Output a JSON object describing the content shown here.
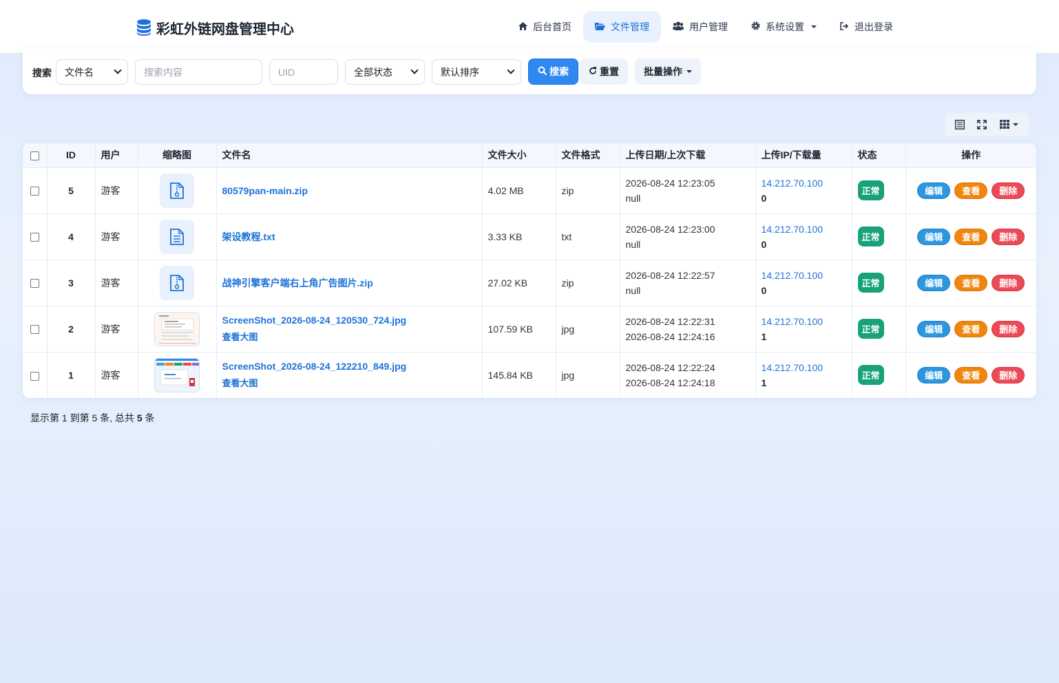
{
  "brand": {
    "title": "彩虹外链网盘管理中心",
    "icon": "database-icon",
    "icon_color": "#1d72d8"
  },
  "nav": [
    {
      "label": "后台首页",
      "icon": "home-icon",
      "active": false
    },
    {
      "label": "文件管理",
      "icon": "folder-open-icon",
      "active": true
    },
    {
      "label": "用户管理",
      "icon": "users-icon",
      "active": false
    },
    {
      "label": "系统设置",
      "icon": "gear-icon",
      "active": false,
      "dropdown": true
    },
    {
      "label": "退出登录",
      "icon": "sign-out-icon",
      "active": false
    }
  ],
  "search": {
    "label": "搜索",
    "field_select": "文件名",
    "keyword_placeholder": "搜索内容",
    "uid_placeholder": "UID",
    "status_select": "全部状态",
    "sort_select": "默认排序",
    "search_button": "搜索",
    "reset_button": "重置",
    "batch_button": "批量操作"
  },
  "toolbar": {
    "icons": [
      "list-icon",
      "fullscreen-icon",
      "columns-icon"
    ]
  },
  "table": {
    "headers": [
      "ID",
      "用户",
      "缩略图",
      "文件名",
      "文件大小",
      "文件格式",
      "上传日期/上次下载",
      "上传IP/下载量",
      "状态",
      "操作"
    ],
    "rows": [
      {
        "id": "5",
        "user": "游客",
        "thumb": "zip-file-icon",
        "name": "80579pan-main.zip",
        "sublink": "",
        "size": "4.02 MB",
        "format": "zip",
        "upload": "2026-08-24 12:23:05",
        "last_download": "null",
        "ip": "14.212.70.100",
        "downloads": "0",
        "status": "正常"
      },
      {
        "id": "4",
        "user": "游客",
        "thumb": "text-file-icon",
        "name": "架设教程.txt",
        "sublink": "",
        "size": "3.33 KB",
        "format": "txt",
        "upload": "2026-08-24 12:23:00",
        "last_download": "null",
        "ip": "14.212.70.100",
        "downloads": "0",
        "status": "正常"
      },
      {
        "id": "3",
        "user": "游客",
        "thumb": "zip-file-icon",
        "name": "战神引擎客户端右上角广告图片.zip",
        "sublink": "",
        "size": "27.02 KB",
        "format": "zip",
        "upload": "2026-08-24 12:22:57",
        "last_download": "null",
        "ip": "14.212.70.100",
        "downloads": "0",
        "status": "正常"
      },
      {
        "id": "2",
        "user": "游客",
        "thumb": "image-thumbnail",
        "name": "ScreenShot_2026-08-24_120530_724.jpg",
        "sublink": "查看大图",
        "size": "107.59 KB",
        "format": "jpg",
        "upload": "2026-08-24 12:22:31",
        "last_download": "2026-08-24 12:24:16",
        "ip": "14.212.70.100",
        "downloads": "1",
        "status": "正常"
      },
      {
        "id": "1",
        "user": "游客",
        "thumb": "image-thumbnail",
        "name": "ScreenShot_2026-08-24_122210_849.jpg",
        "sublink": "查看大图",
        "size": "145.84 KB",
        "format": "jpg",
        "upload": "2026-08-24 12:22:24",
        "last_download": "2026-08-24 12:24:18",
        "ip": "14.212.70.100",
        "downloads": "1",
        "status": "正常"
      }
    ],
    "actions": {
      "edit": "编辑",
      "view": "查看",
      "delete": "删除"
    }
  },
  "pager": {
    "prefix": "显示第 1 到第 5 条, 总共 ",
    "total": "5",
    "suffix": " 条"
  },
  "colors": {
    "primary": "#2f88f0",
    "success": "#17a27a",
    "warning": "#f1860f",
    "danger": "#ec4a55",
    "info": "#2c97de"
  }
}
